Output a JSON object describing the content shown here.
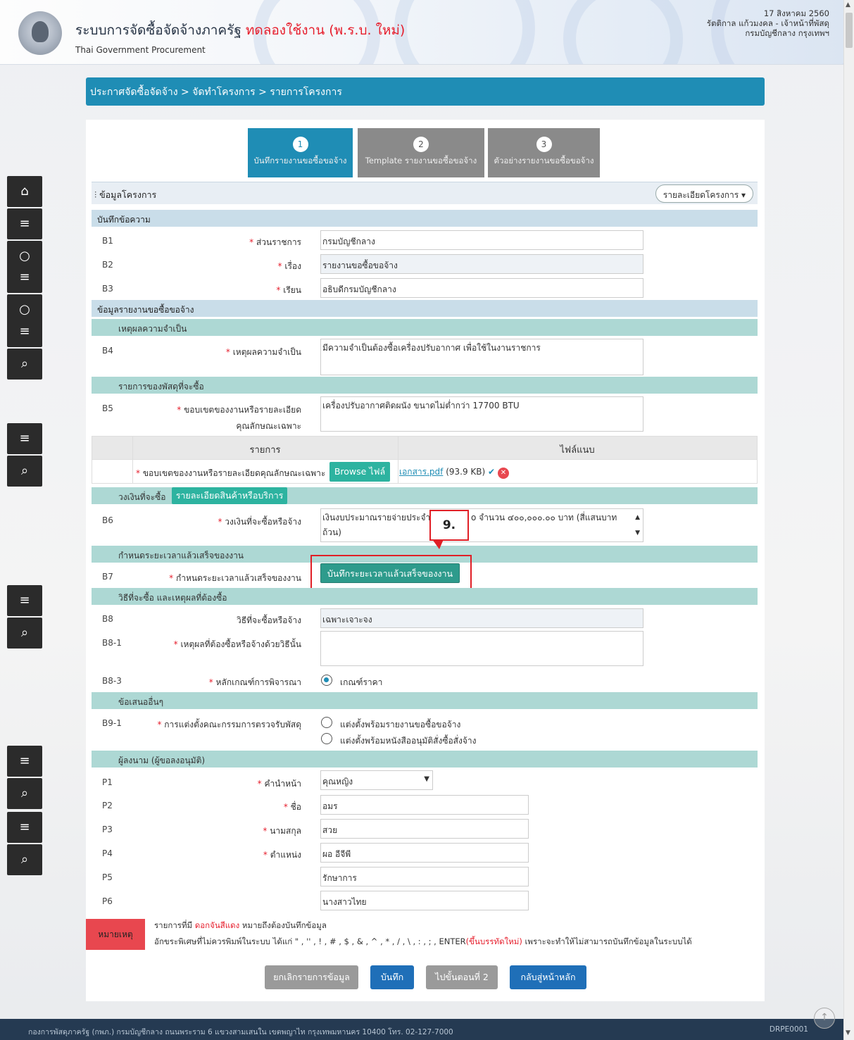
{
  "header": {
    "title": "ระบบการจัดซื้อจัดจ้างภาครัฐ",
    "title_highlight": "ทดลองใช้งาน (พ.ร.บ. ใหม่)",
    "subtitle": "Thai Government Procurement",
    "date": "17 สิงหาคม 2560",
    "user": "รัตติกาล แก้วมงคล - เจ้าหน้าที่พัสดุ",
    "org": "กรมบัญชีกลาง กรุงเทพฯ"
  },
  "breadcrumb": "ประกาศจัดซื้อจัดจ้าง > จัดทำโครงการ > รายการโครงการ",
  "steps": [
    {
      "num": "1",
      "label": "บันทึกรายงานขอซื้อขอจ้าง"
    },
    {
      "num": "2",
      "label": "Template รายงานขอซื้อขอจ้าง"
    },
    {
      "num": "3",
      "label": "ตัวอย่างรายงานขอซื้อขอจ้าง"
    }
  ],
  "project": {
    "title": "ข้อมูลโครงการ",
    "detail_button": "รายละเอียดโครงการ ▾"
  },
  "sections": {
    "memo": "บันทึกข้อความ",
    "report": "ข้อมูลรายงานขอซื้อขอจ้าง",
    "necessity": "เหตุผลความจำเป็น",
    "items": "รายการของพัสดุที่จะซื้อ",
    "budget": "วงเงินที่จะซื้อ",
    "budget_button": "รายละเอียดสินค้าหรือบริการ",
    "deadline": "กำหนดระยะเวลาแล้วเสร็จของงาน",
    "method": "วิธีที่จะซื้อ และเหตุผลที่ต้องซื้อ",
    "other": "ข้อเสนออื่นๆ",
    "signer": "ผู้ลงนาม (ผู้ขอลงอนุมัติ)"
  },
  "fields": {
    "b1": {
      "code": "B1",
      "label": "ส่วนราชการ",
      "value": "กรมบัญชีกลาง"
    },
    "b2": {
      "code": "B2",
      "label": "เรื่อง",
      "value": "รายงานขอซื้อขอจ้าง"
    },
    "b3": {
      "code": "B3",
      "label": "เรียน",
      "value": "อธิบดีกรมบัญชีกลาง"
    },
    "b4": {
      "code": "B4",
      "label": "เหตุผลความจำเป็น",
      "value": "มีความจำเป็นต้องซื้อเครื่องปรับอากาศ เพื่อใช้ในงานราชการ"
    },
    "b5": {
      "code": "B5",
      "label": "ขอบเขตของงานหรือรายละเอียด",
      "label2": "คุณลักษณะเฉพาะ",
      "value": "เครื่องปรับอากาศติดผนัง ขนาดไม่ต่ำกว่า 17700 BTU"
    },
    "b6": {
      "code": "B6",
      "label": "วงเงินที่จะซื้อหรือจ้าง",
      "value_a": "เงินงบประมาณรายจ่ายประจำ",
      "value_b": "o จำนวน ๔๐๐,๐๐๐.๐๐ บาท (สี่แสนบาท",
      "value_c": "ถ้วน)"
    },
    "b7": {
      "code": "B7",
      "label": "กำหนดระยะเวลาแล้วเสร็จของงาน",
      "button": "บันทึกระยะเวลาแล้วเสร็จของงาน"
    },
    "b8": {
      "code": "B8",
      "label": "วิธีที่จะซื้อหรือจ้าง",
      "value": "เฉพาะเจาะจง"
    },
    "b8_1": {
      "code": "B8-1",
      "label": "เหตุผลที่ต้องซื้อหรือจ้างด้วยวิธีนั้น",
      "value": ""
    },
    "b8_3": {
      "code": "B8-3",
      "label": "หลักเกณฑ์การพิจารณา",
      "option": "เกณฑ์ราคา"
    },
    "b9_1": {
      "code": "B9-1",
      "label": "การแต่งตั้งคณะกรรมการตรวจรับพัสดุ",
      "option1": "แต่งตั้งพร้อมรายงานขอซื้อขอจ้าง",
      "option2": "แต่งตั้งพร้อมหนังสืออนุมัติสั่งซื้อสั่งจ้าง"
    },
    "p1": {
      "code": "P1",
      "label": "คำนำหน้า",
      "value": "คุณหญิง"
    },
    "p2": {
      "code": "P2",
      "label": "ชื่อ",
      "value": "อมร"
    },
    "p3": {
      "code": "P3",
      "label": "นามสกุล",
      "value": "สวย"
    },
    "p4": {
      "code": "P4",
      "label": "ตำแหน่ง",
      "value": "ผอ อีจีพี"
    },
    "p5": {
      "code": "P5",
      "label": "",
      "value": "รักษาการ"
    },
    "p6": {
      "code": "P6",
      "label": "",
      "value": "นางสาวไทย"
    }
  },
  "attachment": {
    "col_item": "รายการ",
    "col_file": "ไฟล์แนบ",
    "row_label": "ขอบเขตของงานหรือรายละเอียดคุณลักษณะเฉพาะ",
    "browse": "Browse ไฟล์",
    "file_name": "เอกสาร.pdf",
    "file_size": "(93.9 KB)"
  },
  "callout": "9.",
  "note": {
    "tag": "หมายเหตุ",
    "line1_a": "รายการที่มี ",
    "line1_red": "ดอกจันสีแดง",
    "line1_b": " หมายถึงต้องบันทึกข้อมูล",
    "line2_a": "อักขระพิเศษที่ไม่ควรพิมพ์ในระบบ ได้แก่ \" , '' , ! , # , $ , & , ^ , * , / , \\ , : , ; , ENTER",
    "line2_red": "(ขึ้นบรรทัดใหม่)",
    "line2_b": " เพราะจะทำให้ไม่สามารถบันทึกข้อมูลในระบบได้"
  },
  "buttons": {
    "cancel": "ยกเลิกรายการข้อมูล",
    "save": "บันทึก",
    "next": "ไปขั้นตอนที่ 2",
    "home": "กลับสู่หน้าหลัก"
  },
  "footer": {
    "address": "กองการพัสดุภาครัฐ (กพภ.) กรมบัญชีกลาง ถนนพระราม 6 แขวงสามเสนใน เขตพญาไท กรุงเทพมหานคร 10400 โทร. 02-127-7000",
    "code": "DRPE0001"
  },
  "colors": {
    "accent": "#1f8db5",
    "required": "#e61e2c",
    "section": "#c9dde9",
    "subsection": "#add8d4",
    "primary_button": "#1f6fb8",
    "teal_button": "#2e9b8c"
  }
}
